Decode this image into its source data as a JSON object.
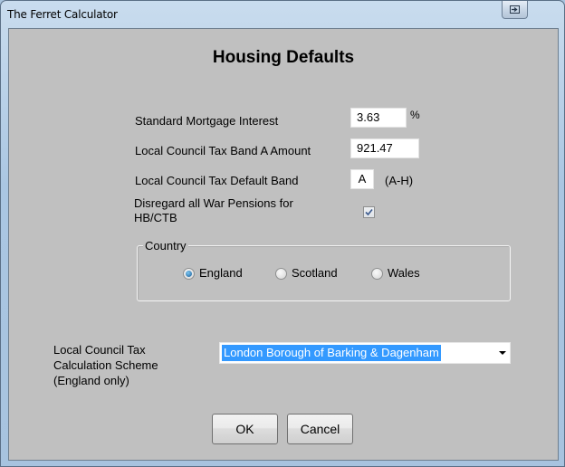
{
  "window": {
    "title": "The Ferret Calculator",
    "titlebar_button_icon": "restore-icon"
  },
  "dialog": {
    "heading": "Housing Defaults",
    "fields": {
      "mortgage_interest": {
        "label": "Standard Mortgage Interest",
        "value": "3.63",
        "unit": "%"
      },
      "band_a_amount": {
        "label": "Local Council Tax Band A Amount",
        "value": "921.47"
      },
      "default_band": {
        "label": "Local Council Tax Default Band",
        "value": "A",
        "hint": "(A-H)"
      },
      "war_pensions": {
        "label_line1": "Disregard all War Pensions for",
        "label_line2": "HB/CTB",
        "checked": true
      }
    },
    "country": {
      "legend": "Country",
      "options": [
        {
          "label": "England",
          "selected": true
        },
        {
          "label": "Scotland",
          "selected": false
        },
        {
          "label": "Wales",
          "selected": false
        }
      ]
    },
    "scheme": {
      "label_line1": "Local Council Tax",
      "label_line2": "Calculation Scheme",
      "label_line3": "(England only)",
      "selected": "London Borough of Barking & Dagenham"
    },
    "buttons": {
      "ok": "OK",
      "cancel": "Cancel"
    }
  }
}
